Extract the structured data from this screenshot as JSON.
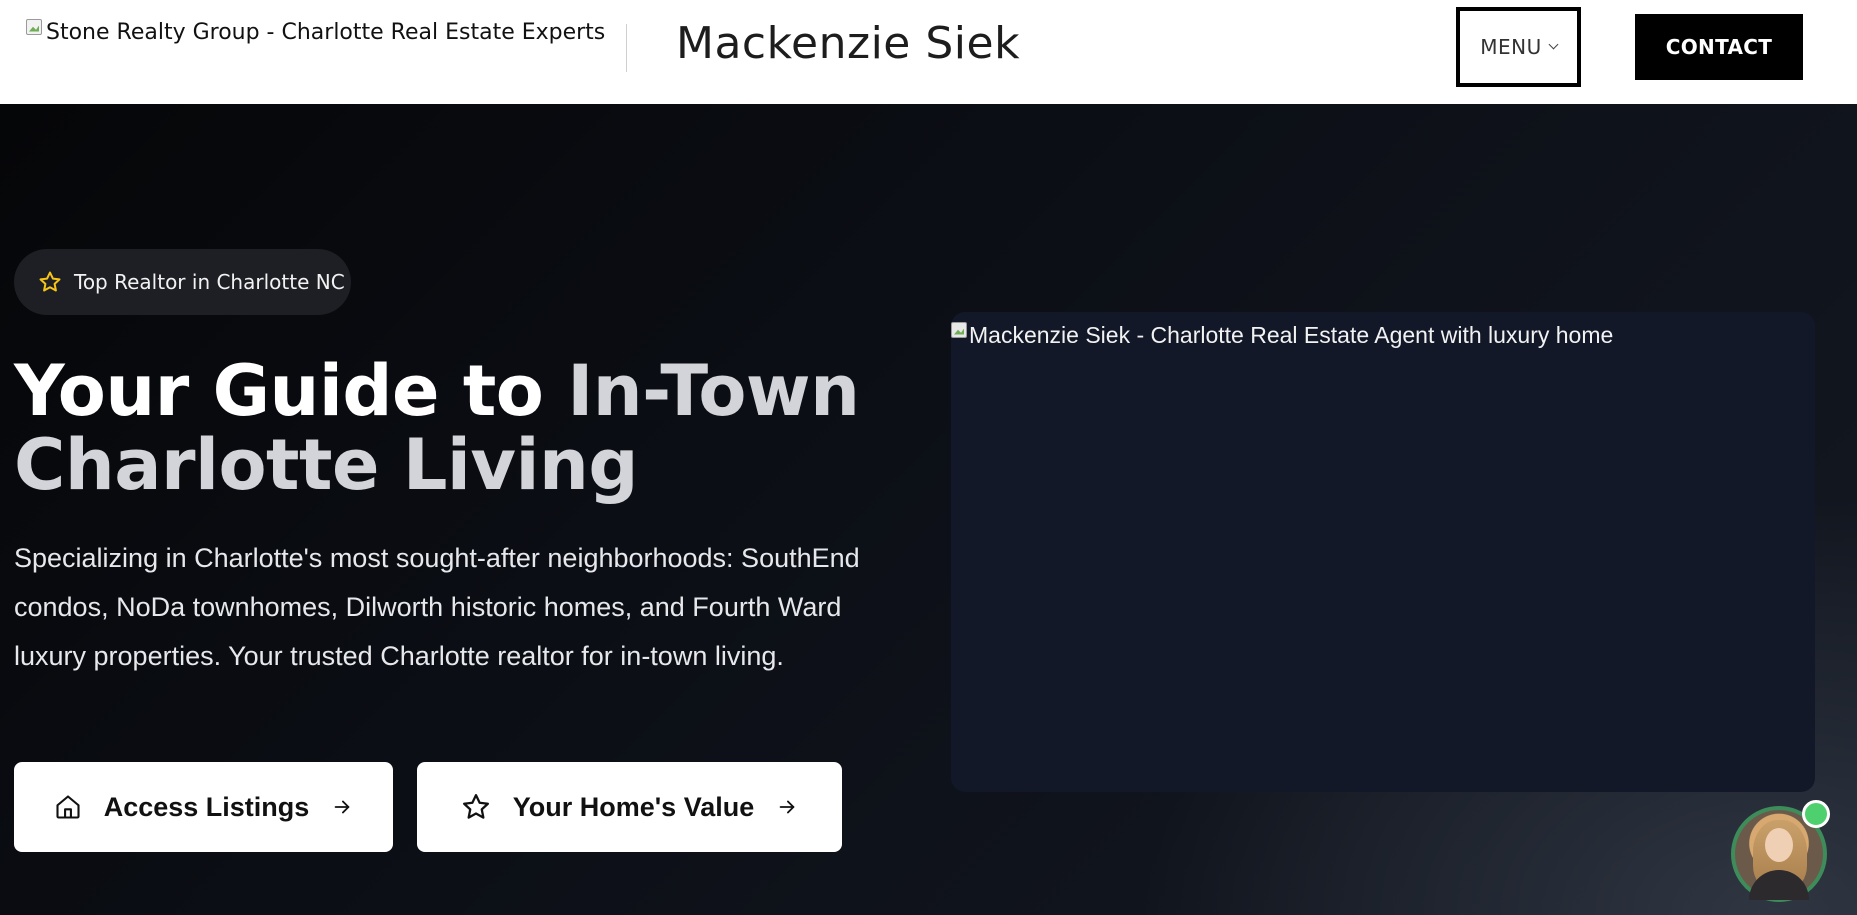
{
  "header": {
    "logo_alt": "Stone Realty Group - Charlotte Real Estate Experts",
    "agent_name": "Mackenzie Siek",
    "menu_label": "MENU",
    "contact_label": "CONTACT"
  },
  "hero": {
    "badge_text": "Top Realtor in Charlotte NC",
    "headline_part1": "Your Guide to ",
    "headline_part2": "In-Town Charlotte Living",
    "description": "Specializing in Charlotte's most sought-after neighborhoods: SouthEnd condos, NoDa townhomes, Dilworth historic homes, and Fourth Ward luxury properties. Your trusted Charlotte realtor for in-town living.",
    "cta_listings": "Access Listings",
    "cta_value": "Your Home's Value",
    "image_alt": "Mackenzie Siek - Charlotte Real Estate Agent with luxury home"
  },
  "icons": {
    "badge": "star-icon",
    "listings": "home-icon",
    "value": "star-icon",
    "arrow": "arrow-right-icon",
    "menu_caret": "chevron-down-icon"
  },
  "colors": {
    "header_bg": "#ffffff",
    "hero_bg": "#0a0b0f",
    "star_accent": "#f5c518",
    "online_status": "#4ed06f",
    "avatar_ring": "#3d8c5a"
  }
}
